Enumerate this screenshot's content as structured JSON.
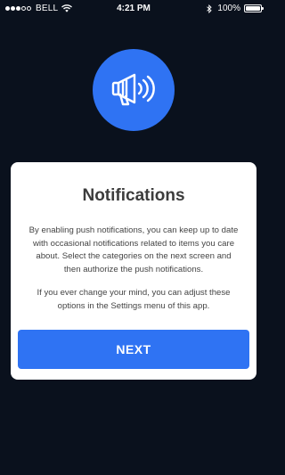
{
  "status_bar": {
    "carrier": "BELL",
    "time": "4:21 PM",
    "battery": "100%",
    "signal_filled_dots": 3,
    "signal_total_dots": 5
  },
  "hero": {
    "icon": "megaphone-icon",
    "color": "#2f73f3"
  },
  "dialog": {
    "title": "Notifications",
    "paragraph1": "By enabling push notifications, you can keep up to date with occasional notifications related to items you care about. Select the categories on the next screen and then authorize the push notifications.",
    "paragraph2": "If you ever change your mind, you can adjust these options in the Settings menu of this app.",
    "next_label": "NEXT"
  },
  "colors": {
    "background": "#0a111d",
    "accent": "#2f73f3",
    "card": "#ffffff"
  }
}
